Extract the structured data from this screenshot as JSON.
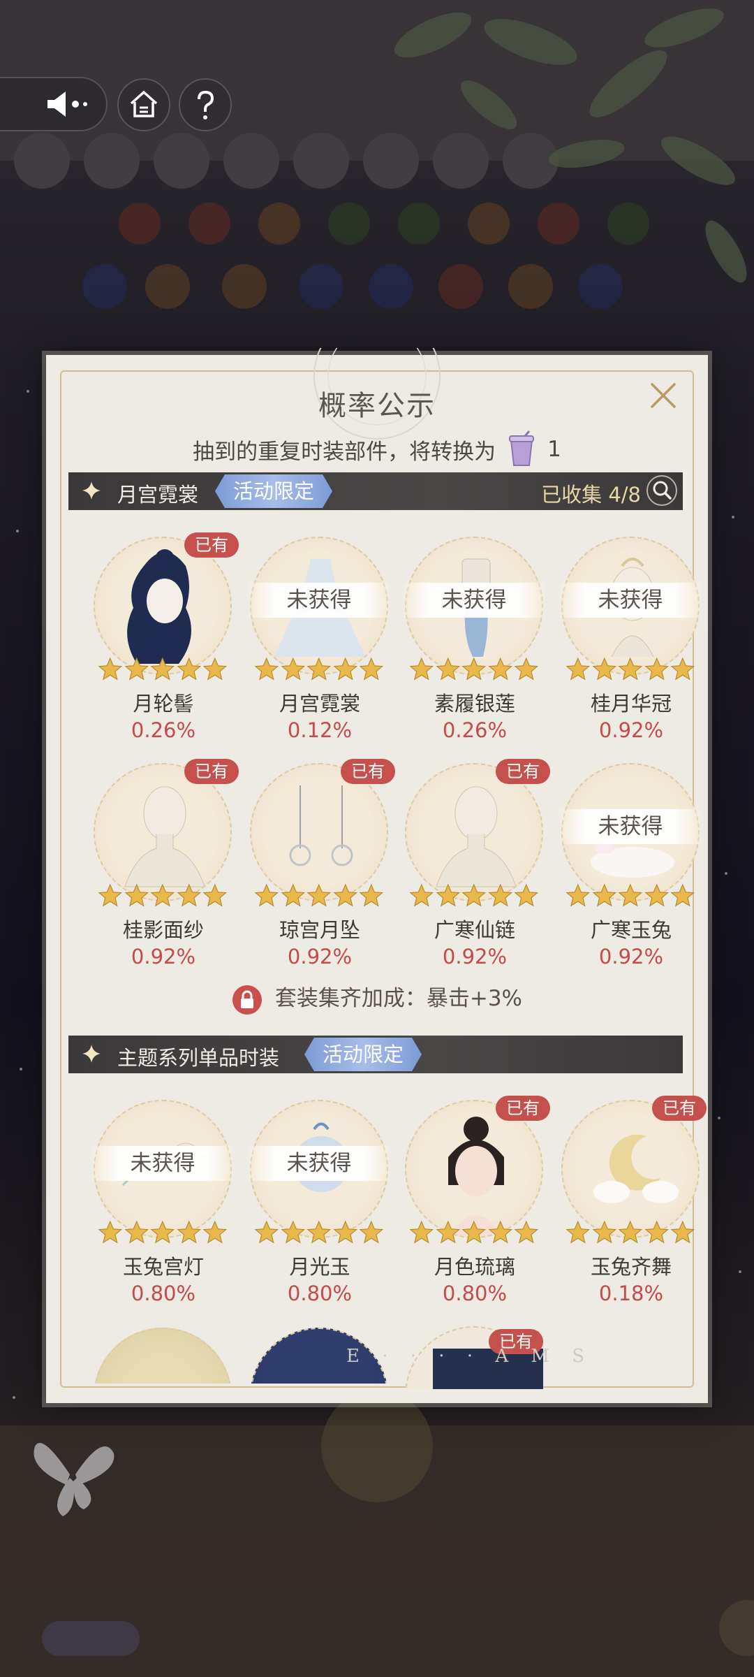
{
  "topbar": {
    "sound_icon": "speaker-icon",
    "home_icon": "home-icon",
    "help_icon": "question-icon"
  },
  "modal": {
    "title": "概率公示",
    "subtitle": "抽到的重复时装部件，将转换为",
    "subtitle_count": "1",
    "close_icon": "close-icon"
  },
  "section1": {
    "title": "月宫霓裳",
    "tag": "活动限定",
    "collected": "已收集 4/8",
    "items": [
      {
        "name": "月轮髻",
        "prob": "0.26%",
        "status": "已有"
      },
      {
        "name": "月宫霓裳",
        "prob": "0.12%",
        "status": "未获得"
      },
      {
        "name": "素履银莲",
        "prob": "0.26%",
        "status": "未获得"
      },
      {
        "name": "桂月华冠",
        "prob": "0.92%",
        "status": "未获得"
      },
      {
        "name": "桂影面纱",
        "prob": "0.92%",
        "status": "已有"
      },
      {
        "name": "琼宫月坠",
        "prob": "0.92%",
        "status": "已有"
      },
      {
        "name": "广寒仙链",
        "prob": "0.92%",
        "status": "已有"
      },
      {
        "name": "广寒玉兔",
        "prob": "0.92%",
        "status": "未获得"
      }
    ],
    "bonus": "套装集齐加成：暴击+3%"
  },
  "section2": {
    "title": "主题系列单品时装",
    "tag": "活动限定",
    "items": [
      {
        "name": "玉兔宫灯",
        "prob": "0.80%",
        "status": "未获得"
      },
      {
        "name": "月光玉",
        "prob": "0.80%",
        "status": "未获得"
      },
      {
        "name": "月色琉璃",
        "prob": "0.80%",
        "status": "已有"
      },
      {
        "name": "玉兔齐舞",
        "prob": "0.18%",
        "status": "已有"
      }
    ],
    "peek_status": "已有"
  },
  "colors": {
    "owned_badge": "#c6504c",
    "prob_text": "#c54a4a",
    "tag_blue": "#8ea9df",
    "section_bar": "#3f3c3c",
    "star_gold": "#e8b84a"
  }
}
